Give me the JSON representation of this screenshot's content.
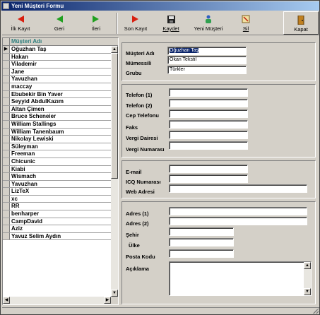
{
  "window": {
    "title": "Yeni Müşteri Formu"
  },
  "toolbar": {
    "first": "İlk Kayıt",
    "prev": "Geri",
    "next": "İleri",
    "last": "Son Kayıt",
    "save": "Kaydet",
    "new_customer": "Yeni Müşteri",
    "delete": "Sil",
    "close": "Kapat"
  },
  "list": {
    "header": "Müşteri Adı",
    "current_indicator": "▶",
    "items": [
      "Oğuzhan  Taş",
      "Hakan",
      "Vilademir",
      "Jane",
      "Yavuzhan",
      "maccay",
      "Ebubekir Bin Yaver",
      "Seyyid AbdulKazım",
      "Altan Çimen",
      "Bruce Scheneier",
      "William Stallings",
      "William Tanenbaum",
      "Nikolay Lewiski",
      "Süleyman",
      "Freeman",
      "Chicunic",
      "Kiabi",
      "Wismach",
      "Yavuzhan",
      "LizTeX",
      "xc",
      "RR",
      "benharper",
      "CampDavid",
      "Aziz",
      "Yavuz Selim Aydın"
    ]
  },
  "form": {
    "customer_name_label": "Müşteri Adı",
    "customer_name_value": "Oğuzhan  Taş",
    "representative_label": "Mümessili",
    "representative_value": "Okan Tekstil",
    "group_label": "Grubu",
    "group_value": "Türkler",
    "phone1_label": "Telefon (1)",
    "phone2_label": "Telefon (2)",
    "mobile_label": "Cep Telefonu",
    "fax_label": "Faks",
    "tax_office_label": "Vergi Dairesi",
    "tax_number_label": "Vergi Numarası",
    "email_label": "E-mail",
    "icq_label": "ICQ Numarası",
    "web_label": "Web Adresi",
    "address1_label": "Adres (1)",
    "address2_label": "Adres (2)",
    "city_label": "Şehir",
    "country_label": "Ülke",
    "postal_label": "Posta Kodu",
    "notes_label": "Açıklama"
  }
}
